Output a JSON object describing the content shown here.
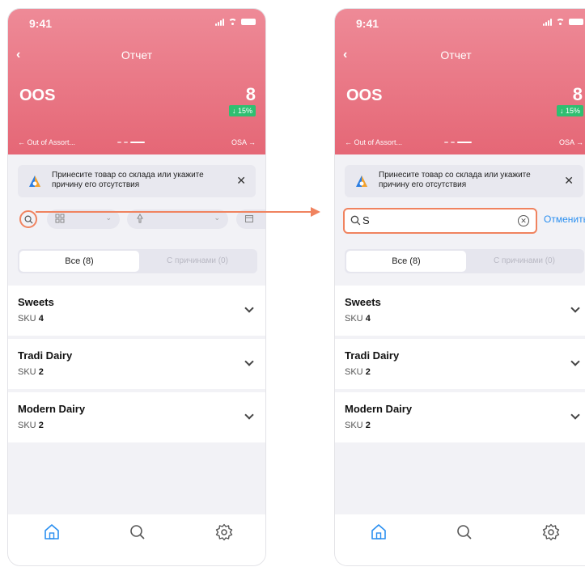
{
  "status": {
    "time": "9:41"
  },
  "screen": {
    "back_icon": "chevron-left-icon",
    "title": "Отчет",
    "metric_name": "OOS",
    "metric_value": "8",
    "delta": "↓ 15%",
    "prev_label": "← Out of Assort...",
    "next_label": "OSA →"
  },
  "banner": {
    "text": "Принесите товар со склада или укажите причину его отсутствия",
    "close": "✕"
  },
  "search": {
    "value": "S",
    "cancel_label": "Отменить"
  },
  "segments": {
    "all": "Все (8)",
    "with_reasons": "С причинами (0)"
  },
  "categories": [
    {
      "name": "Sweets",
      "sku_label": "SKU",
      "sku_count": "4"
    },
    {
      "name": "Tradi Dairy",
      "sku_label": "SKU",
      "sku_count": "2"
    },
    {
      "name": "Modern Dairy",
      "sku_label": "SKU",
      "sku_count": "2"
    }
  ],
  "tabbar": {
    "items": [
      "home-icon",
      "search-icon",
      "gear-icon"
    ],
    "active": "home-icon"
  },
  "colors": {
    "header": "#e56776",
    "accent": "#f0835f",
    "delta": "#2fbf71",
    "active_tab": "#2a8ff0",
    "link": "#2a8ff0"
  }
}
